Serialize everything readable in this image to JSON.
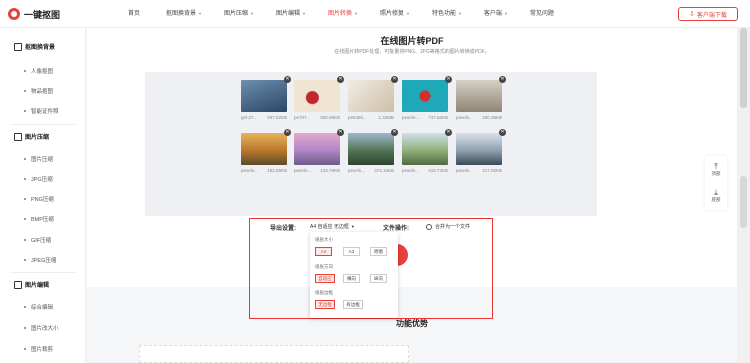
{
  "logo": {
    "text": "一键抠图"
  },
  "nav": [
    {
      "label": "首页",
      "caret": false,
      "active": false
    },
    {
      "label": "抠图换背景",
      "caret": true,
      "active": false
    },
    {
      "label": "图片压缩",
      "caret": true,
      "active": false
    },
    {
      "label": "图片编辑",
      "caret": true,
      "active": false
    },
    {
      "label": "图片转换",
      "caret": true,
      "active": true
    },
    {
      "label": "照片修复",
      "caret": true,
      "active": false
    },
    {
      "label": "特色功能",
      "caret": true,
      "active": false
    },
    {
      "label": "客户端",
      "caret": true,
      "active": false
    },
    {
      "label": "常见问题",
      "caret": false,
      "active": false
    }
  ],
  "download": {
    "label": "客户端下载",
    "icon": "download-icon"
  },
  "sidebar": {
    "sections": [
      {
        "title": "抠图换背景",
        "items": [
          "人像抠图",
          "物品抠图",
          "智能证件照"
        ]
      },
      {
        "title": "图片压缩",
        "items": [
          "图片压缩",
          "JPG压缩",
          "PNG压缩",
          "BMP压缩",
          "GIF压缩",
          "JPEG压缩"
        ]
      },
      {
        "title": "图片编辑",
        "items": [
          "综合编辑",
          "图片改大小",
          "图片裁剪"
        ]
      }
    ]
  },
  "main": {
    "title": "在线图片转PDF",
    "subtitle": "在线图片转PDF处理，可批量将PNG、JPG等格式的图片转换成PDF。",
    "thumbnails": [
      {
        "name": "girl-27...",
        "size": "937.52KB",
        "color": "#3b5a7a"
      },
      {
        "name": "pe707...",
        "size": "900.06KB",
        "color": "#e9dccc"
      },
      {
        "name": "pe5450...",
        "size": "1.34MB",
        "color": "#e4ddd2"
      },
      {
        "name": "pexels-...",
        "size": "747.66KB",
        "color": "#1ea8b8"
      },
      {
        "name": "pexels...",
        "size": "330.38KB",
        "color": "#b8aea0"
      },
      {
        "name": "pexels...",
        "size": "182.69KB",
        "color": "#c98a3a"
      },
      {
        "name": "pexels-...",
        "size": "143.79KB",
        "color": "#c9a0c8"
      },
      {
        "name": "pexels...",
        "size": "374.16KB",
        "color": "#5b7c5a"
      },
      {
        "name": "pexels...",
        "size": "418.74KB",
        "color": "#7a9a6a"
      },
      {
        "name": "pexels...",
        "size": "217.06KB",
        "color": "#8ea0b0"
      }
    ],
    "close_glyph": "✕",
    "export": {
      "label": "导出设置:",
      "selected": "A4 自适应 无边框",
      "file_label": "文件操作:",
      "merge_label": "合并为一个文件"
    },
    "dropdown": {
      "size_label": "纸张大小",
      "sizes": [
        "A4",
        "A3",
        "原图"
      ],
      "orient_label": "纸张方向",
      "orients": [
        "自适应",
        "横向",
        "纵向"
      ],
      "border_label": "纸张边框",
      "borders": [
        "无边框",
        "有边框"
      ]
    },
    "features_title": "功能优势"
  },
  "float": [
    {
      "label": "顶部",
      "icon": "to-top-icon",
      "glyph": "⤒"
    },
    {
      "label": "底部",
      "icon": "to-bottom-icon",
      "glyph": "⤓"
    }
  ],
  "colors": {
    "accent": "#e8403a"
  }
}
